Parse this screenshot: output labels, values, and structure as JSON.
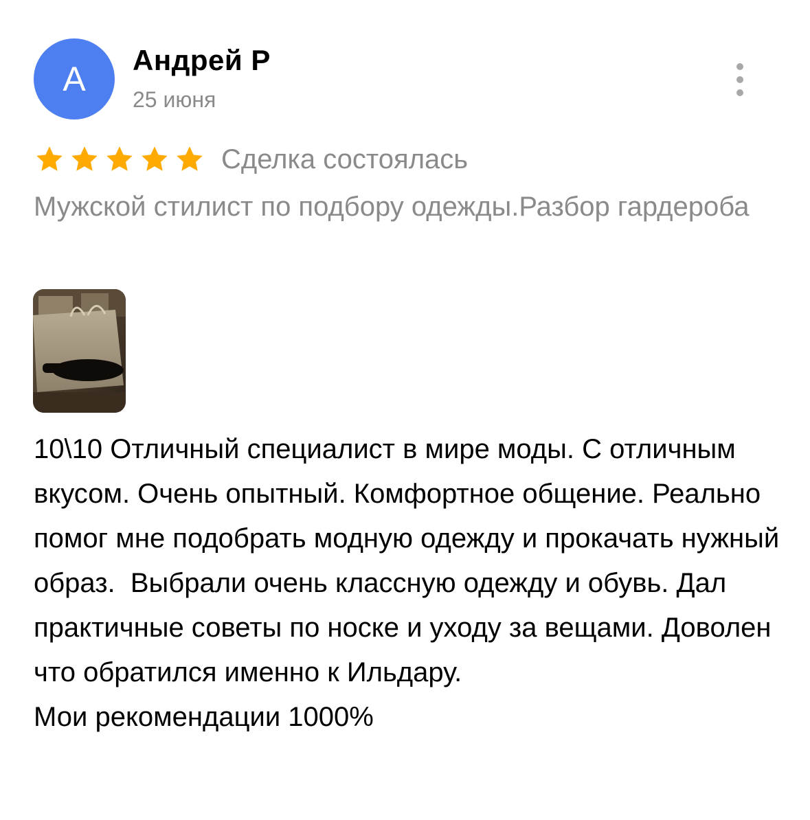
{
  "review": {
    "author": {
      "initial": "А",
      "name": "Андрей Р",
      "avatar_color": "#4e7ff0"
    },
    "date": "25 июня",
    "menu_icon": "more-vertical-icon",
    "rating": {
      "stars": 5,
      "max": 5,
      "star_color": "#ffaa00",
      "star_icon": "star-icon"
    },
    "deal_status": "Сделка состоялась",
    "service_title": "Мужской стилист по подбору одежды.Разбор гардероба",
    "photo": {
      "description_icon": "review-photo-thumbnail",
      "count": 1
    },
    "text": "10\\10 Отличный специалист в мире моды. С отличным вкусом. Очень опытный. Комфортное общение. Реально помог мне подобрать модную одежду и прокачать нужный образ.  Выбрали очень классную одежду и обувь. Дал практичные советы по носке и уходу за вещами. Доволен что обратился именно к Ильдару.\nМои рекомендации 1000%"
  }
}
